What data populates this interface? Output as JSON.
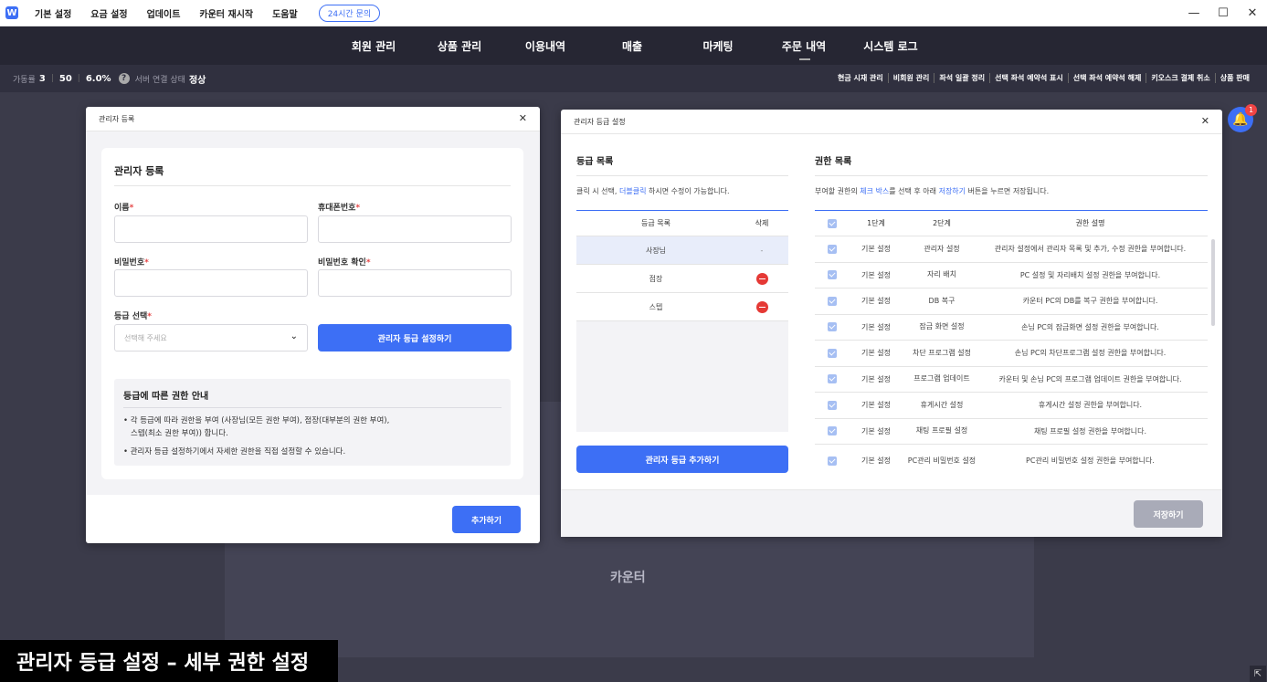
{
  "titlebar": {
    "logo": "W",
    "menu": [
      "기본 설정",
      "요금 설정",
      "업데이트",
      "카운터 재시작",
      "도움말"
    ],
    "support": "24시간 문의",
    "controls": [
      "minimize-icon",
      "maximize-icon",
      "close-icon"
    ]
  },
  "nav": {
    "items": [
      "회원 관리",
      "상품 관리",
      "이용내역",
      "매출",
      "마케팅",
      "주문 내역",
      "시스템 로그"
    ],
    "active": "주문 내역"
  },
  "status": {
    "occupancy_label": "가동률",
    "occupancy_used": "3",
    "occupancy_total": "50",
    "occupancy_rate": "6.0%",
    "server_label": "서버 연결 상태",
    "server_value": "정상",
    "actions": [
      "현금 시재 관리",
      "비회원 관리",
      "좌석 일괄 정리",
      "선택 좌석 예약석 표시",
      "선택 좌석 예약석 해제",
      "키오스크 결제 취소",
      "상품 판매"
    ]
  },
  "background": {
    "counter_label": "카운터"
  },
  "notification": {
    "count": "1"
  },
  "admin_register": {
    "dialog_title": "관리자 등록",
    "card_title": "관리자 등록",
    "name_label": "이름",
    "phone_label": "휴대폰번호",
    "password_label": "비밀번호",
    "password_confirm_label": "비밀번호 확인",
    "grade_label": "등급 선택",
    "grade_placeholder": "선택해 주세요",
    "grade_setting_button": "관리자 등급 설정하기",
    "info_title": "등급에 따른 권한 안내",
    "info_line1": "• 각 등급에 따라 권한을 부여 (사장님(모든 권한 부여), 점장(대부분의 권한 부여),",
    "info_line2": "스텝(최소 권한 부여)) 합니다.",
    "info_line3": "• 관리자 등급 설정하기에서 자세한 권한을 직접 설정할 수 있습니다.",
    "add_button": "추가하기",
    "required_mark": "*"
  },
  "grade_settings": {
    "dialog_title": "관리자 등급 설정",
    "grade_list_title": "등급 목록",
    "grade_list_desc_prefix": "클릭 시 선택, ",
    "grade_list_desc_hl": "더블클릭",
    "grade_list_desc_suffix": " 하시면 수정이 가능합니다.",
    "grade_columns": [
      "등급 목록",
      "삭제"
    ],
    "grades": [
      {
        "name": "사장님",
        "delete": "-"
      },
      {
        "name": "점장",
        "delete": "remove-icon"
      },
      {
        "name": "스텝",
        "delete": "remove-icon"
      }
    ],
    "add_grade_button": "관리자 등급 추가하기",
    "perm_list_title": "권한 목록",
    "perm_desc_p1": "부여할 권한의 ",
    "perm_desc_hl1": "체크 박스",
    "perm_desc_p2": "를 선택 후 아래 ",
    "perm_desc_hl2": "저장하기",
    "perm_desc_p3": " 버튼을 누르면 저장됩니다.",
    "perm_columns": [
      "1단계",
      "2단계",
      "권한 설명"
    ],
    "permissions": [
      {
        "l1": "기본 설정",
        "l2": "관리자 설정",
        "desc": "관리자 설정에서 관리자 목록 및 추가, 수정 권한을 부여합니다."
      },
      {
        "l1": "기본 설정",
        "l2": "자리 배치",
        "desc": "PC 설정 및 자리배치 설정 권한을 부여합니다."
      },
      {
        "l1": "기본 설정",
        "l2": "DB 복구",
        "desc": "카운터 PC의 DB를 복구 권한을 부여합니다."
      },
      {
        "l1": "기본 설정",
        "l2": "잠금 화면 설정",
        "desc": "손님 PC의 잠금화면 설정 권한을 부여합니다."
      },
      {
        "l1": "기본 설정",
        "l2": "차단 프로그램 설정",
        "desc": "손님 PC의 차단프로그램 설정 권한을 부여합니다."
      },
      {
        "l1": "기본 설정",
        "l2": "프로그램 업데이트",
        "desc": "카운터 및 손님 PC의 프로그램 업데이트 권한을 부여합니다."
      },
      {
        "l1": "기본 설정",
        "l2": "휴게시간 설정",
        "desc": "휴게시간 설정 권한을 부여합니다."
      },
      {
        "l1": "기본 설정",
        "l2": "채팅 프로필 설정",
        "desc": "채팅 프로필 설정 권한을 부여합니다."
      },
      {
        "l1": "기본 설정",
        "l2": "PC관리 비밀번호 설정",
        "desc": "PC관리 비밀번호 설정 권한을 부여합니다."
      }
    ],
    "save_button": "저장하기"
  },
  "caption": "관리자 등급 설정 – 세부 권한 설정",
  "colors": {
    "accent": "#3d6ff5",
    "nav_bg": "#262633",
    "danger": "#e53935",
    "save_disabled": "#a9abb8"
  }
}
